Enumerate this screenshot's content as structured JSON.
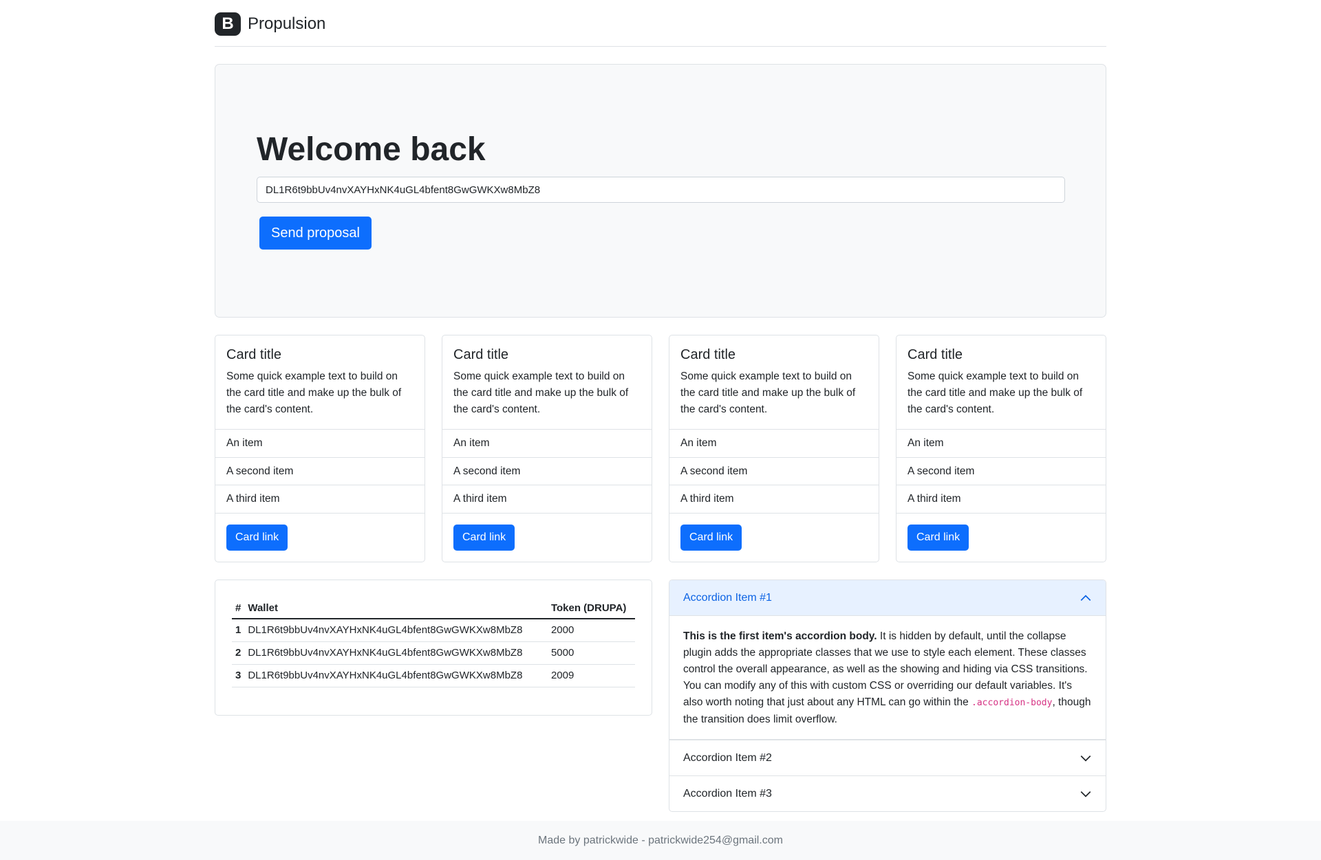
{
  "header": {
    "brand_icon_letter": "B",
    "brand_name": "Propulsion"
  },
  "hero": {
    "title": "Welcome back",
    "input_value": "DL1R6t9bbUv4nvXAYHxNK4uGL4bfent8GwGWKXw8MbZ8",
    "button_label": "Send proposal"
  },
  "cards": [
    {
      "title": "Card title",
      "text": "Some quick example text to build on the card title and make up the bulk of the card's content.",
      "items": [
        "An item",
        "A second item",
        "A third item"
      ],
      "link_label": "Card link"
    },
    {
      "title": "Card title",
      "text": "Some quick example text to build on the card title and make up the bulk of the card's content.",
      "items": [
        "An item",
        "A second item",
        "A third item"
      ],
      "link_label": "Card link"
    },
    {
      "title": "Card title",
      "text": "Some quick example text to build on the card title and make up the bulk of the card's content.",
      "items": [
        "An item",
        "A second item",
        "A third item"
      ],
      "link_label": "Card link"
    },
    {
      "title": "Card title",
      "text": "Some quick example text to build on the card title and make up the bulk of the card's content.",
      "items": [
        "An item",
        "A second item",
        "A third item"
      ],
      "link_label": "Card link"
    }
  ],
  "wallet_table": {
    "headers": [
      "#",
      "Wallet",
      "Token (DRUPA)"
    ],
    "rows": [
      {
        "index": "1",
        "wallet": "DL1R6t9bbUv4nvXAYHxNK4uGL4bfent8GwGWKXw8MbZ8",
        "token": "2000"
      },
      {
        "index": "2",
        "wallet": "DL1R6t9bbUv4nvXAYHxNK4uGL4bfent8GwGWKXw8MbZ8",
        "token": "5000"
      },
      {
        "index": "3",
        "wallet": "DL1R6t9bbUv4nvXAYHxNK4uGL4bfent8GwGWKXw8MbZ8",
        "token": "2009"
      }
    ]
  },
  "accordion": {
    "items": [
      {
        "title": "Accordion Item #1",
        "expanded": true
      },
      {
        "title": "Accordion Item #2",
        "expanded": false
      },
      {
        "title": "Accordion Item #3",
        "expanded": false
      }
    ],
    "body_bold": "This is the first item's accordion body.",
    "body_text": " It is hidden by default, until the collapse plugin adds the appropriate classes that we use to style each element. These classes control the overall appearance, as well as the showing and hiding via CSS transitions. You can modify any of this with custom CSS or overriding our default variables. It's also worth noting that just about any HTML can go within the ",
    "body_code": ".accordion-body",
    "body_tail": ", though the transition does limit overflow."
  },
  "footer": {
    "text": "Made by patrickwide - patrickwide254@gmail.com"
  },
  "colors": {
    "primary": "#0d6efd",
    "accordion_active_bg": "#e7f1ff",
    "accordion_active_text": "#0c63e4",
    "hero_bg": "#f8f9fa"
  }
}
